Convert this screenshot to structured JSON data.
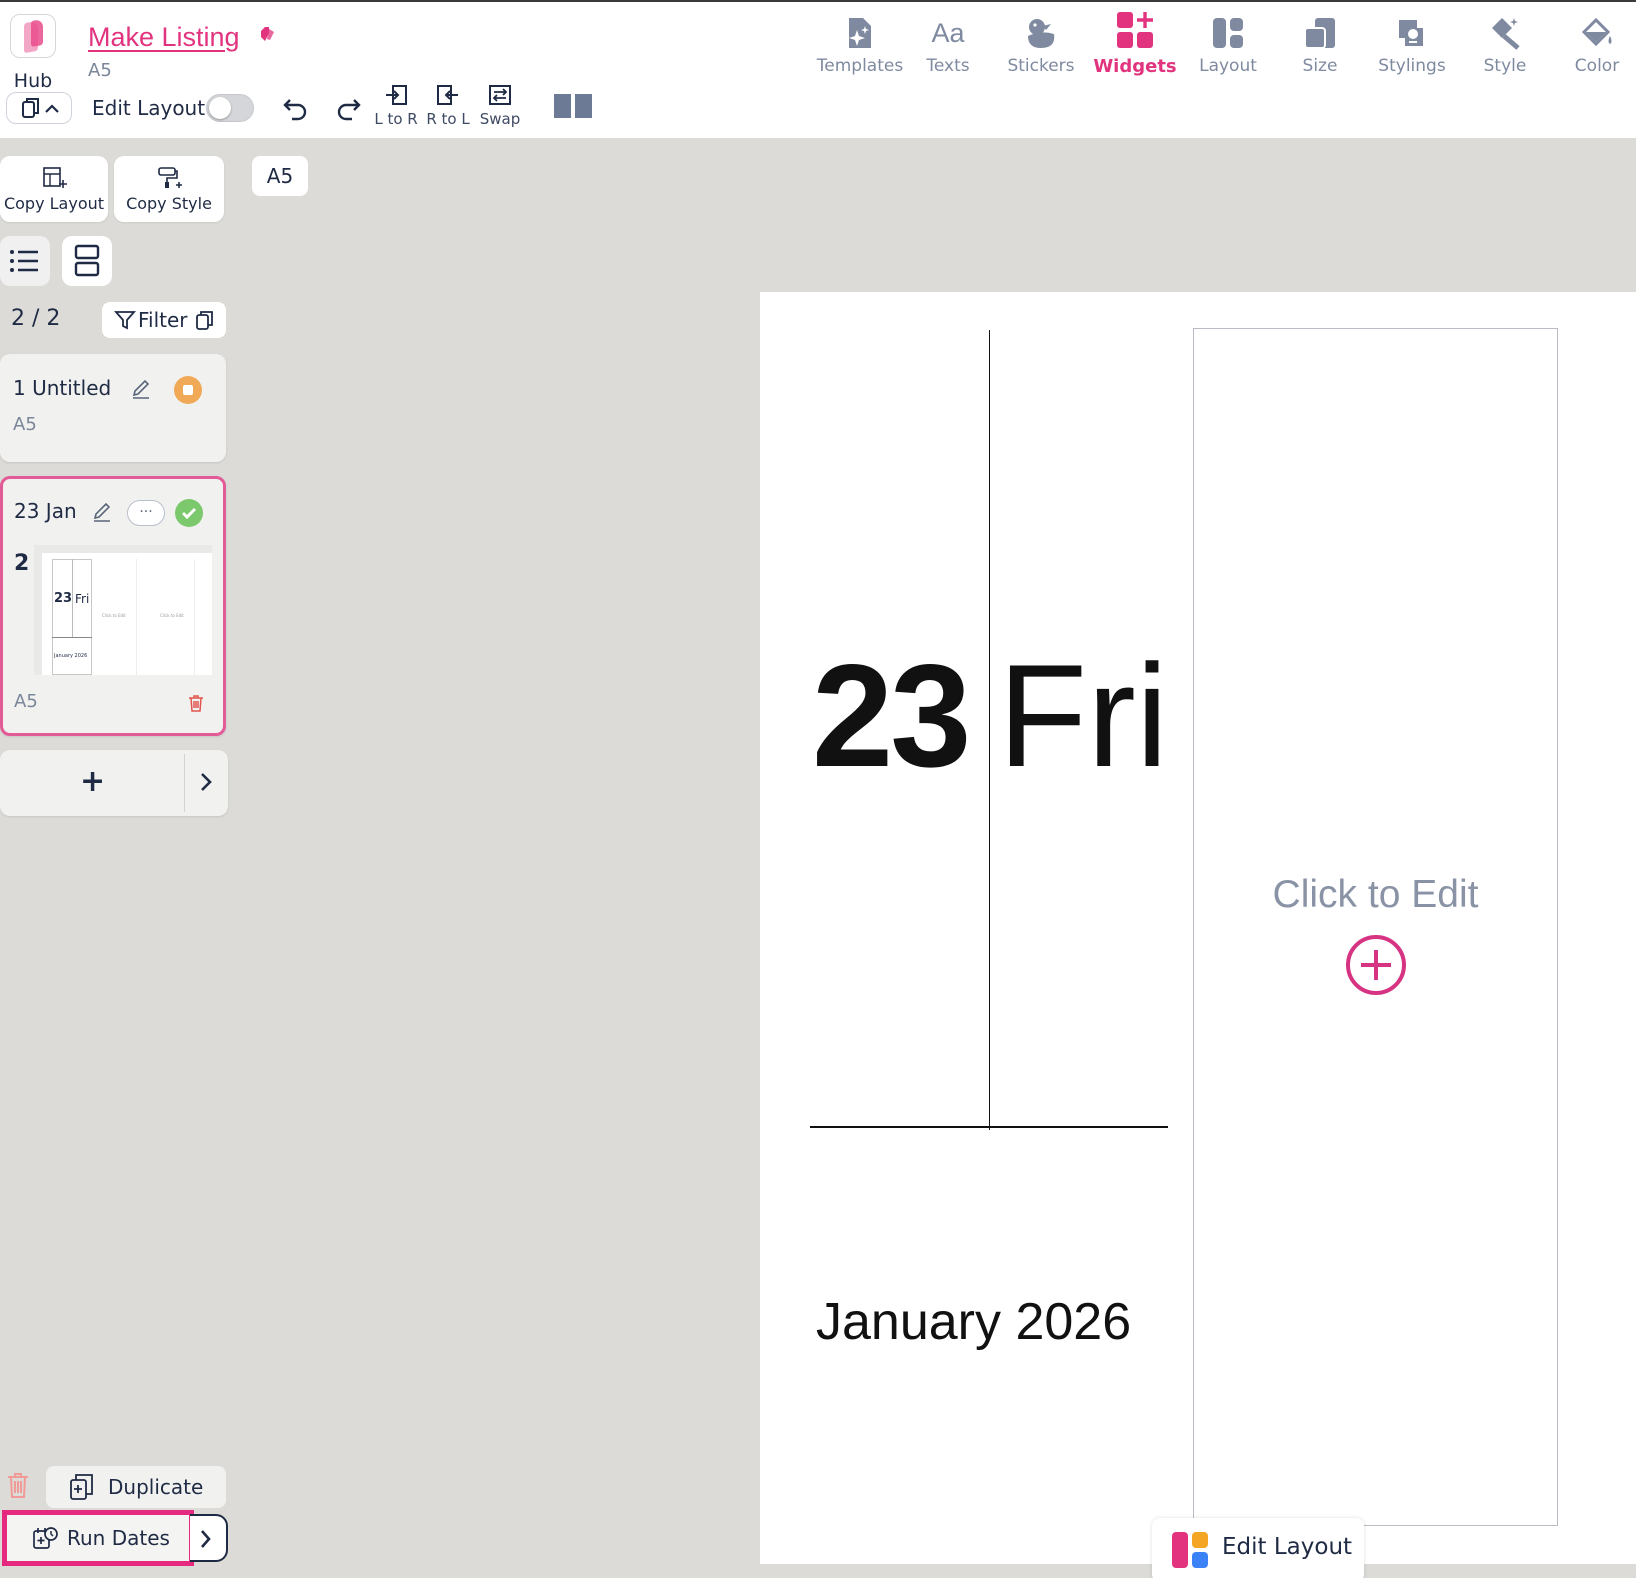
{
  "header": {
    "hub_label": "Hub",
    "page_title": "Make Listing",
    "page_size": "A5",
    "edit_layout_label": "Edit Layout",
    "edit_layout_on": false,
    "arrange": {
      "l_to_r": "L to R",
      "r_to_l": "R to L",
      "swap": "Swap"
    }
  },
  "toolbar": {
    "tools": [
      {
        "label": "Templates",
        "icon": "templates-icon",
        "active": false
      },
      {
        "label": "Texts",
        "icon": "texts-icon",
        "active": false
      },
      {
        "label": "Stickers",
        "icon": "stickers-icon",
        "active": false
      },
      {
        "label": "Widgets",
        "icon": "widgets-icon",
        "active": true
      },
      {
        "label": "Layout",
        "icon": "layout-icon",
        "active": false
      },
      {
        "label": "Size",
        "icon": "size-icon",
        "active": false
      },
      {
        "label": "Stylings",
        "icon": "stylings-icon",
        "active": false
      },
      {
        "label": "Style",
        "icon": "style-icon",
        "active": false
      },
      {
        "label": "Color",
        "icon": "color-icon",
        "active": false
      }
    ]
  },
  "sidebar": {
    "copy_layout": "Copy Layout",
    "copy_style": "Copy Style",
    "size_chip": "A5",
    "page_count": "2 / 2",
    "filter_label": "Filter",
    "pages": [
      {
        "title": "1 Untitled",
        "size": "A5",
        "status": "pending"
      },
      {
        "title": "23 Jan",
        "size": "A5",
        "status": "done",
        "number": "2",
        "more": "···"
      }
    ],
    "thumb": {
      "day": "23",
      "weekday": "Fri",
      "month": "January 2026",
      "edit": "Click to Edit"
    },
    "add_label": "+",
    "duplicate_label": "Duplicate",
    "run_dates_label": "Run Dates"
  },
  "canvas": {
    "day": "23",
    "weekday": "Fri",
    "month_year": "January 2026",
    "placeholder": "Click to Edit"
  },
  "floating": {
    "edit_layout_label": "Edit Layout"
  },
  "colors": {
    "accent": "#e2337f",
    "pending": "#f0a957",
    "done": "#7cc96d",
    "ink": "#1f2a44"
  }
}
